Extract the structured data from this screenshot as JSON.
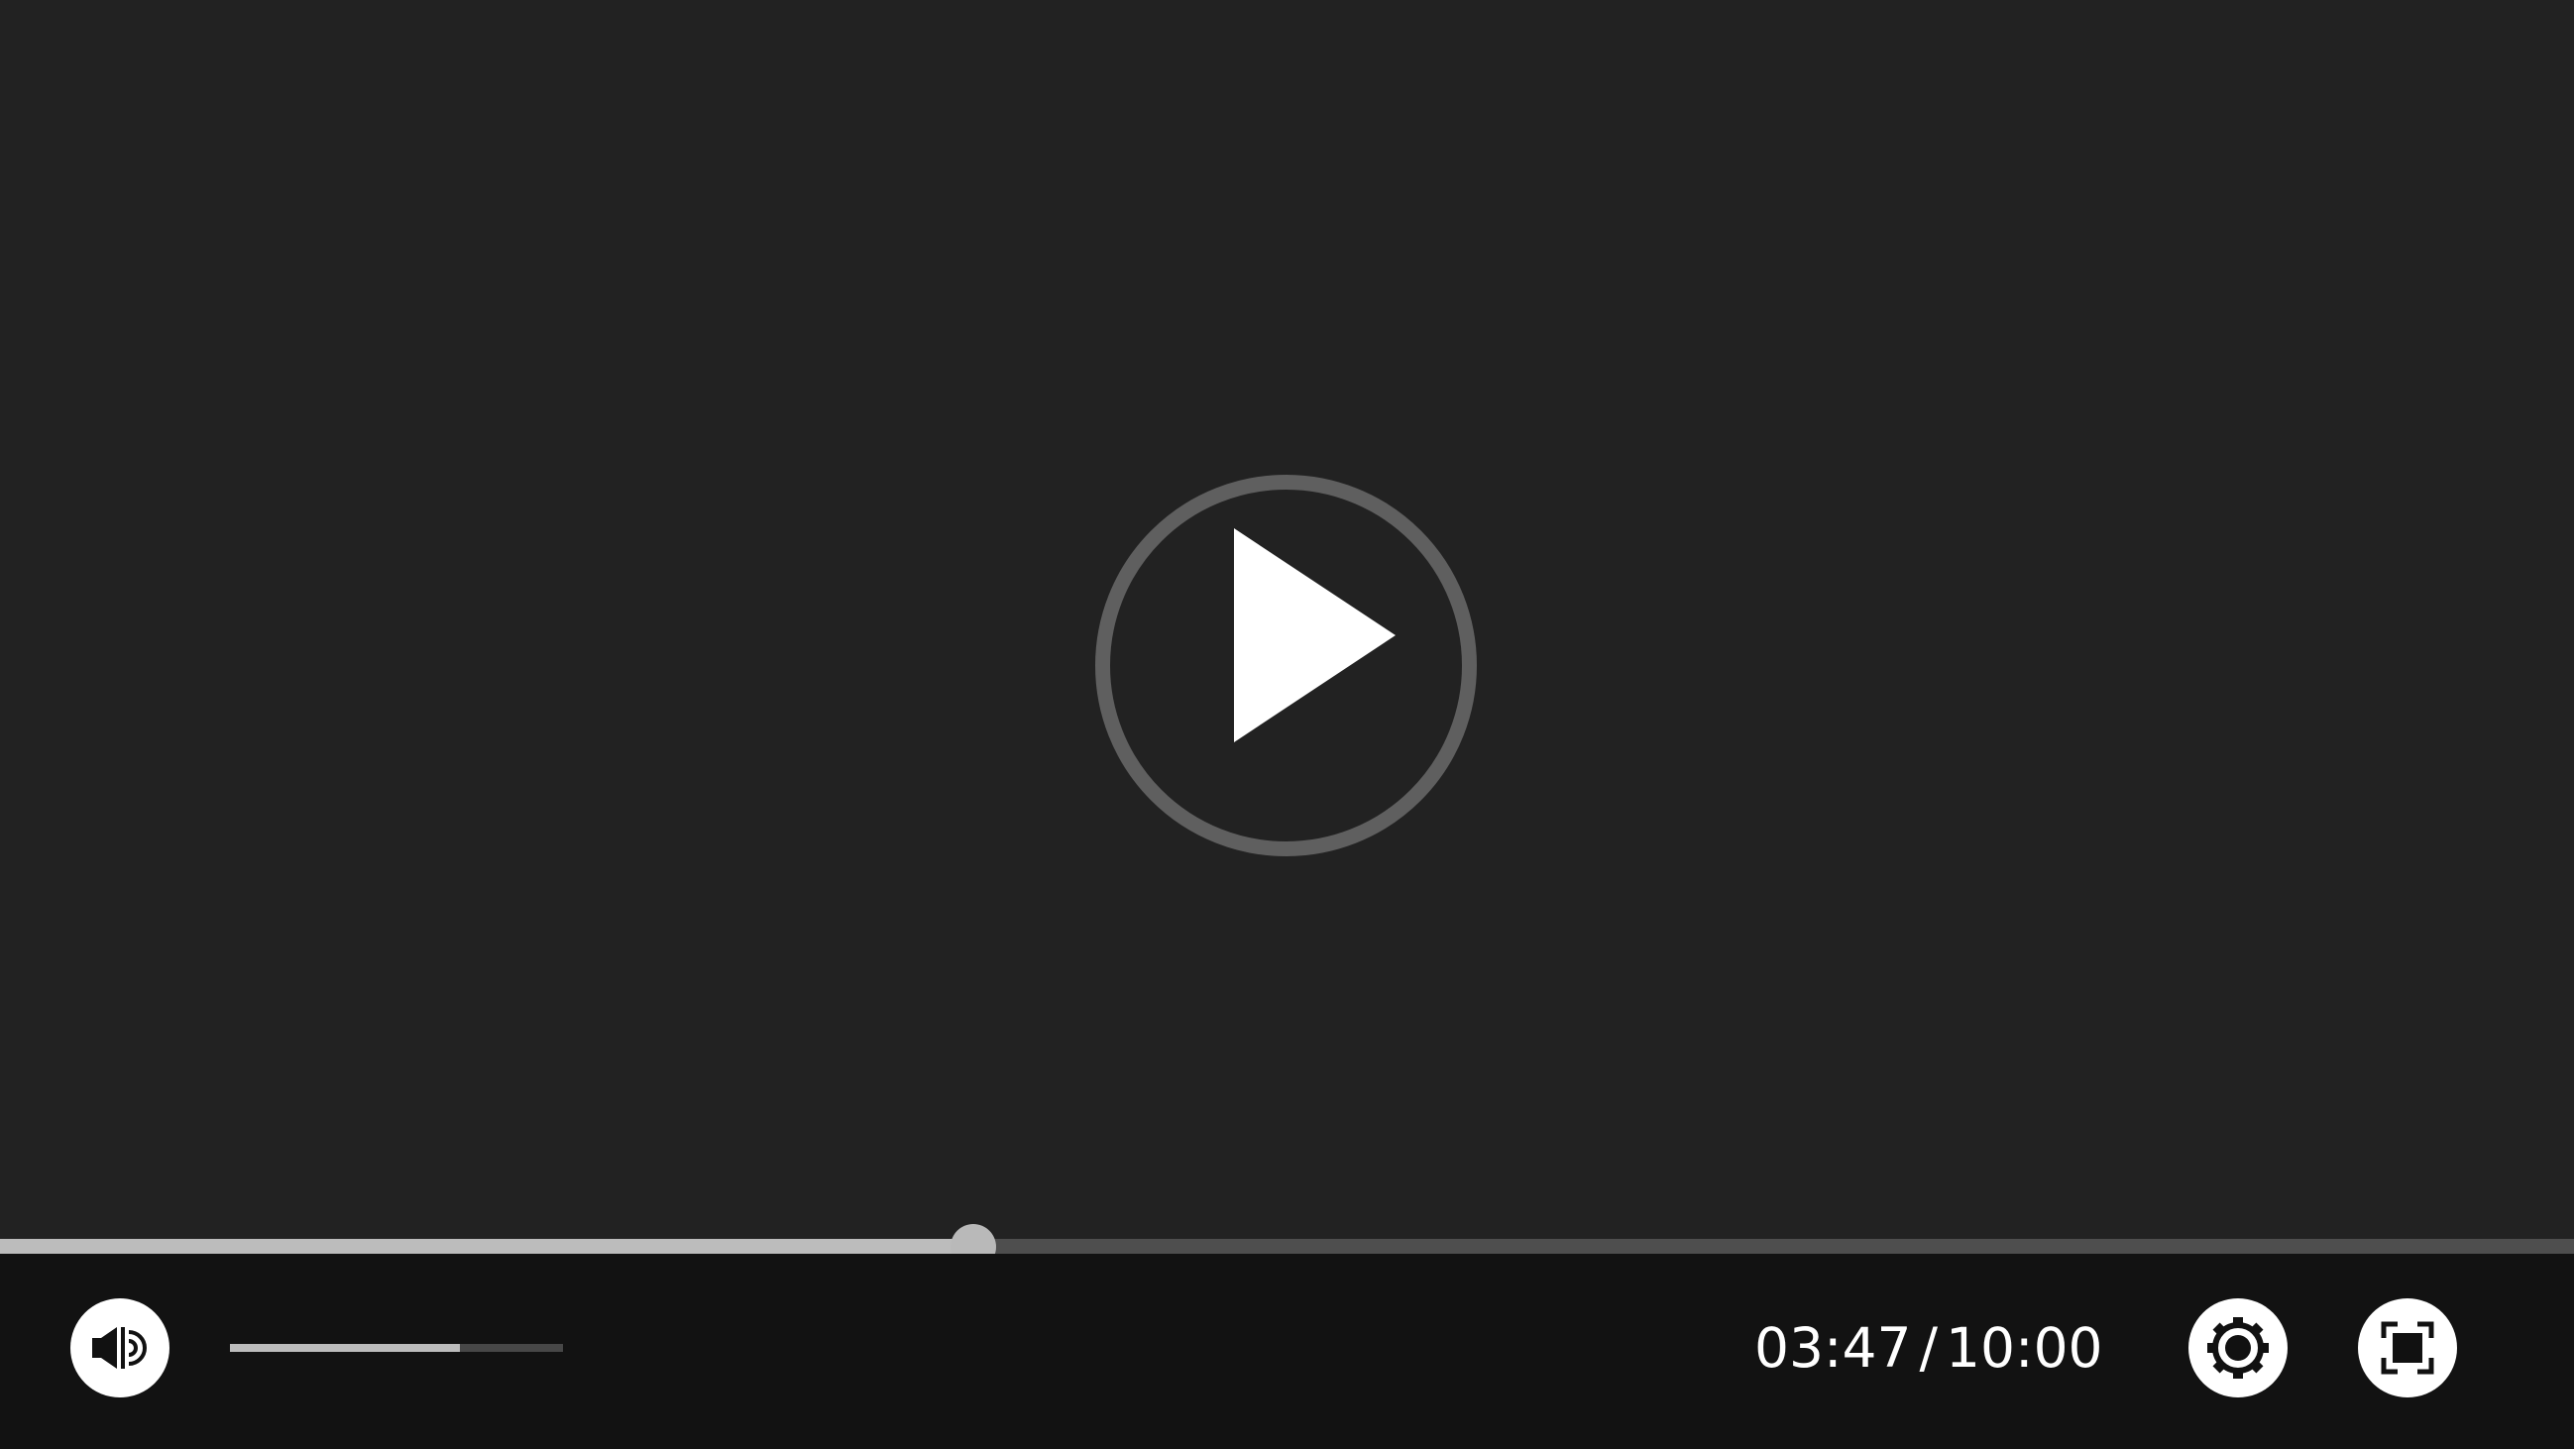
{
  "player": {
    "progress_fraction": 0.3783,
    "volume_fraction": 0.69,
    "time": {
      "current": "03:47",
      "separator": "/",
      "duration": "10:00"
    },
    "icons": {
      "big_play": "play-icon",
      "volume": "volume-speaker-icon",
      "settings": "gear-icon",
      "fullscreen": "fullscreen-icon"
    },
    "colors": {
      "video_background": "#222222",
      "control_bar": "#121212",
      "progress_played": "#bcbcbc",
      "progress_remaining": "#4e4e4e",
      "button_fill": "#ffffff",
      "play_ring": "#5f5f5f"
    }
  }
}
